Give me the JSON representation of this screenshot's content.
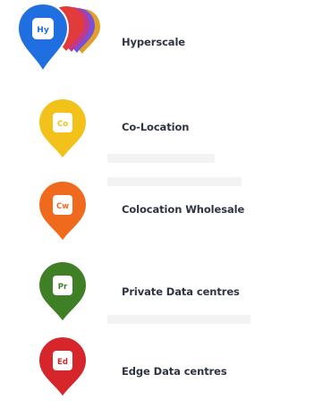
{
  "legend": {
    "items": [
      {
        "label": "Hyperscale",
        "icon": "hyperscale-pin-icon",
        "glyph": "Hy",
        "color": "#1f6fe0",
        "stack_colors": [
          "#e23b3b",
          "#c0398a",
          "#7b4fd6",
          "#e0a12a"
        ]
      },
      {
        "label": "Co-Location",
        "icon": "co-location-pin-icon",
        "glyph": "Co",
        "color": "#f2c21b"
      },
      {
        "label": "Colocation Wholesale",
        "icon": "colocation-wholesale-pin-icon",
        "glyph": "Cw",
        "color": "#ef6a1c"
      },
      {
        "label": "Private Data centres",
        "icon": "private-data-centre-pin-icon",
        "glyph": "Pr",
        "color": "#3f7f25"
      },
      {
        "label": "Edge Data centres",
        "icon": "edge-data-centre-pin-icon",
        "glyph": "Ed",
        "color": "#d6262b"
      }
    ]
  }
}
